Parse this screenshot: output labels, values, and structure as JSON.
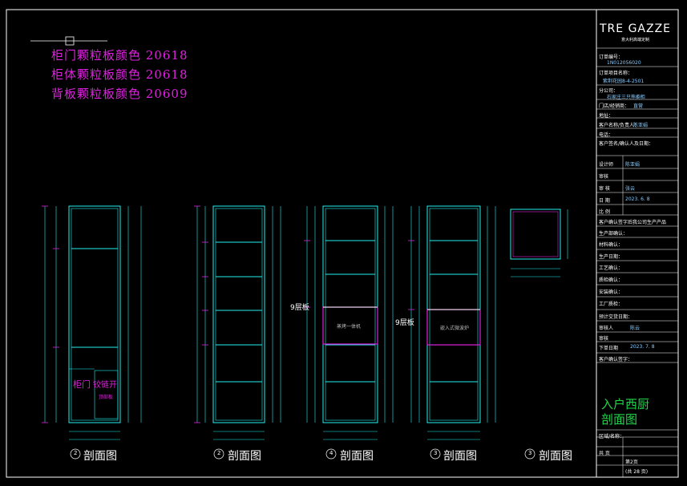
{
  "notes": [
    "柜门颗粒板颜色  20618",
    "柜体颗粒板颜色  20618",
    "背板颗粒板颜色  20609"
  ],
  "section_labels": [
    "剖面图",
    "剖面图",
    "剖面图",
    "剖面图",
    "剖面图"
  ],
  "section_badges": [
    "2",
    "2",
    "4",
    "3",
    "3"
  ],
  "inline_labels": {
    "door_note": "柜门",
    "hinge_note": "铰链开",
    "small_note": "顶部板",
    "unit1": "蒸烤一体机",
    "unit2": "嵌入式微波炉",
    "side_mark_a": "9层板",
    "side_mark_b": "9层板"
  },
  "title_block": {
    "logo": "TRE GAZZE",
    "logo_sub": "意大利高端定制",
    "rows": [
      "订单编号：",
      "订单项目名称：",
      "分公司：",
      "门店/经销商：",
      "地址：",
      "客户名称/负责人：",
      "电话：",
      "客户签名/确认人及日期：",
      "设计师",
      "审核",
      "审 核",
      "日 期",
      "比 例",
      "客户确认签字后我公司生产产品",
      "生产部确认：",
      "材料确认：",
      "生产日期：",
      "工艺确认：",
      "质检确认：",
      "安装确认：",
      "工厂质检：",
      "预计交货日期：",
      "审核人",
      "审核",
      "下单日期",
      "客户确认签字："
    ],
    "values": {
      "order_no": "1N012056020",
      "project": "紫荆花园8-4-2501",
      "branch": "石家庄三只熊橱柜",
      "store": "直营",
      "contact": "陈亚娟",
      "designer": "陈亚娟",
      "checker": "张云",
      "date": "2023. 6. 8",
      "reviewer": "陈云",
      "order_date": "2023. 7. 8"
    },
    "big_title_1": "入户西厨",
    "big_title_2": "剖面图",
    "footer_rows": [
      "区域/名称：",
      "共 页",
      "第2页",
      "(共 28 页)"
    ]
  }
}
